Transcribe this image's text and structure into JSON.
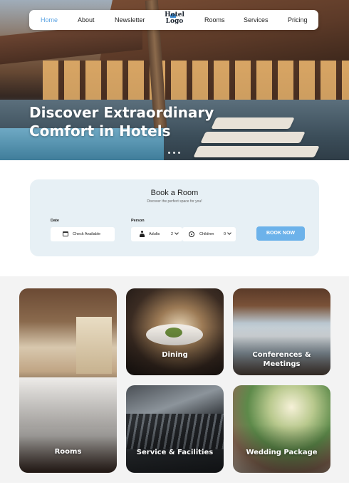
{
  "nav": {
    "items": [
      "Home",
      "About",
      "Newsletter",
      "Rooms",
      "Services",
      "Pricing"
    ],
    "active": "Home",
    "logo_line1": "Hotel",
    "logo_line2": "Logo"
  },
  "hero": {
    "title_line1": "Discover Extraordinary",
    "title_line2": "Comfort in Hotels",
    "slide_count": 3
  },
  "booking": {
    "title": "Book a Room",
    "subtitle": "Discover the perfect space for you!",
    "date_label": "Date",
    "date_value": "Check Available",
    "person_label": "Person",
    "adults_label": "Adults",
    "adults_value": "2",
    "children_label": "Children",
    "children_value": "0",
    "button_label": "BOOK NOW"
  },
  "categories": {
    "rooms": "Rooms",
    "dining": "Dining",
    "conferences_line1": "Conferences &",
    "conferences_line2": "Meetings",
    "services": "Service & Facilities",
    "wedding": "Wedding Package"
  },
  "colors": {
    "accent": "#5aa3e3",
    "button": "#6cb2ea",
    "booking_bg": "#e7f0f5",
    "section_bg": "#f3f3f3"
  }
}
